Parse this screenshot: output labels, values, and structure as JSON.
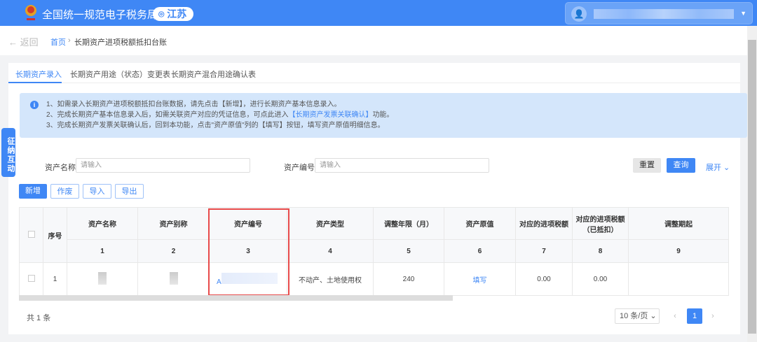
{
  "header": {
    "title": "全国统一规范电子税务局",
    "region": "江苏"
  },
  "breadcrumb": {
    "back": "← 返回",
    "home": "首页",
    "sep": "›",
    "current": "长期资产进项税额抵扣台账"
  },
  "tabs": [
    "长期资产录入",
    "长期资产用途（状态）变更表",
    "长期资产混合用途确认表"
  ],
  "info": {
    "line1": "1、如需录入长期资产进项税额抵扣台账数据，请先点击【新增】，进行长期资产基本信息录入。",
    "line2a": "2、完成长期资产基本信息录入后，如需关联资产对应的凭证信息，可点此进入",
    "line2link": "【长期资产发票关联确认】",
    "line2b": "功能。",
    "line3": "3、完成长期资产发票关联确认后，回到本功能，点击\"资产原值\"列的【填写】按钮，填写资产原值明细信息。"
  },
  "side_tab": "征纳互动",
  "search": {
    "name_label": "资产名称",
    "name_placeholder": "请输入",
    "code_label": "资产编号",
    "code_placeholder": "请输入",
    "reset": "重置",
    "query": "查询",
    "expand": "展开 ⌄"
  },
  "actions": {
    "add": "新增",
    "void": "作废",
    "import": "导入",
    "export": "导出"
  },
  "table": {
    "headers": [
      "序号",
      "资产名称",
      "资产别称",
      "资产编号",
      "资产类型",
      "调整年限（月）",
      "资产原值",
      "对应的进项税额",
      "对应的进项税额（已抵扣）",
      "调整期起"
    ],
    "numbers": [
      "1",
      "2",
      "3",
      "4",
      "5",
      "6",
      "7",
      "8",
      "9"
    ],
    "rows": [
      {
        "seq": "1",
        "code_prefix": "A",
        "type": "不动产、土地使用权",
        "months": "240",
        "value_action": "填写",
        "tax": "0.00",
        "tax_deducted": "0.00",
        "start": ""
      }
    ]
  },
  "footer": {
    "total": "共 1 条",
    "page_size": "10 条/页 ⌄",
    "prev": "‹",
    "page": "1",
    "next": "›"
  },
  "colors": {
    "primary": "#3f87f5",
    "highlight": "#e84a4a"
  }
}
